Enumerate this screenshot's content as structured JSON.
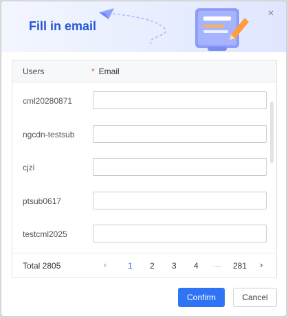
{
  "dialog": {
    "title": "Fill in email",
    "close_icon": "×"
  },
  "table": {
    "col_users": "Users",
    "col_email_required_mark": "*",
    "col_email": "Email",
    "rows": [
      {
        "user": "cml20280871",
        "email": ""
      },
      {
        "user": "ngcdn-testsub",
        "email": ""
      },
      {
        "user": "cjzi",
        "email": ""
      },
      {
        "user": "ptsub0617",
        "email": ""
      },
      {
        "user": "testcml2025",
        "email": ""
      }
    ]
  },
  "pagination": {
    "total": "Total 2805",
    "prev_icon": "‹",
    "pages": [
      "1",
      "2",
      "3",
      "4"
    ],
    "current_page": "1",
    "ellipsis": "···",
    "last_page": "281",
    "next_icon": "›"
  },
  "footer": {
    "confirm_label": "Confirm",
    "cancel_label": "Cancel"
  },
  "colors": {
    "title": "#2457d6",
    "primary": "#2f74f5",
    "active_page": "#2a6fe0",
    "required": "#e34d4d"
  }
}
